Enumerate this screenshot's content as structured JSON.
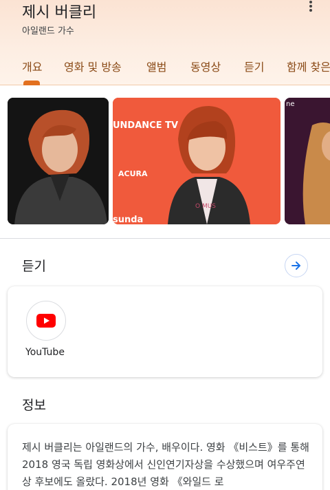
{
  "header": {
    "title": "제시 버클리",
    "subtitle": "아일랜드 가수"
  },
  "tabs": [
    {
      "label": "개요",
      "selected": true
    },
    {
      "label": "영화 및 방송"
    },
    {
      "label": "앨범"
    },
    {
      "label": "동영상"
    },
    {
      "label": "듣기"
    },
    {
      "label": "함께 찾은"
    }
  ],
  "photos": {
    "banner_text_1": "UNDANCE TV",
    "banner_text_2": "ACURA",
    "banner_text_3": "sunda",
    "shirt_text": "O MUS",
    "corner_text": "ne"
  },
  "listen": {
    "title": "듣기",
    "services": [
      {
        "label": "YouTube",
        "icon": "youtube-icon"
      }
    ]
  },
  "info": {
    "title": "정보",
    "text": "제시 버클리는 아일랜드의 가수, 배우이다. 영화 《비스트》를 통해 2018 영국 독립 영화상에서 신인연기자상을 수상했으며 여우주연상 후보에도 올랐다. 2018년 영화 《와일드 로"
  },
  "colors": {
    "header_bg": "#fbe3d3",
    "tab_text": "#8a4a16",
    "tab_indicator": "#e2701f",
    "youtube_red": "#ff0000",
    "arrow_blue": "#1a73e8"
  }
}
